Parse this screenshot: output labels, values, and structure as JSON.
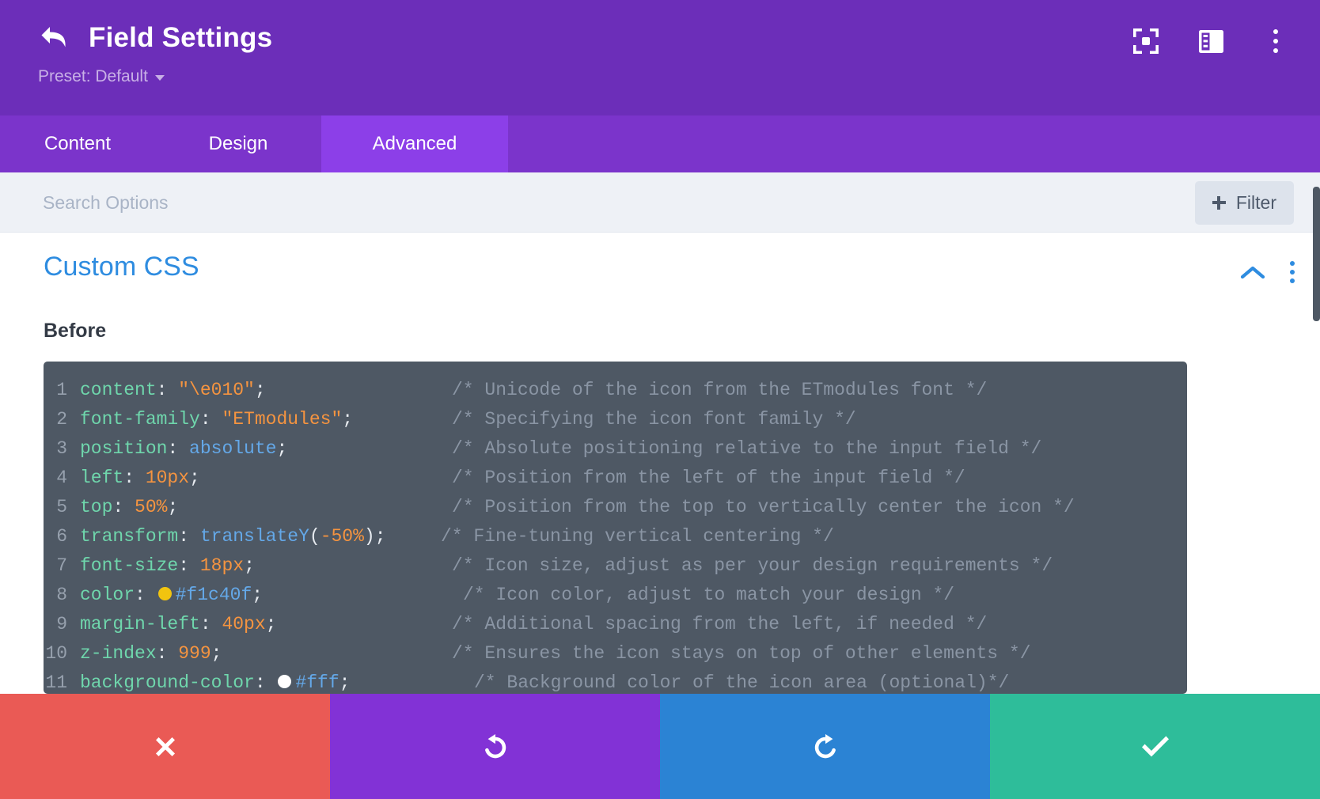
{
  "header": {
    "title": "Field Settings",
    "back_icon": "back-arrow-icon",
    "preset_label": "Preset: Default",
    "actions": [
      {
        "name": "focus-frame-icon",
        "label": "Focus"
      },
      {
        "name": "layout-panel-icon",
        "label": "Layout"
      },
      {
        "name": "more-vertical-icon",
        "label": "More"
      }
    ]
  },
  "tabs": [
    {
      "label": "Content",
      "active": false
    },
    {
      "label": "Design",
      "active": false
    },
    {
      "label": "Advanced",
      "active": true
    }
  ],
  "search": {
    "placeholder": "Search Options",
    "value": "",
    "filter_label": "Filter",
    "filter_icon": "plus-icon"
  },
  "section": {
    "title": "Custom CSS",
    "collapse_icon": "chevron-up-icon",
    "menu_icon": "more-vertical-icon"
  },
  "field": {
    "label": "Before"
  },
  "colors": {
    "header_purple": "#6c2eb9",
    "tab_bar_purple": "#7b34cb",
    "tab_active_purple": "#8c3fe8",
    "preset_text": "#c8b0e6",
    "searchbar_bg": "#eef1f6",
    "filter_bg": "#dde3ec",
    "section_title_blue": "#2e8ce0",
    "code_bg": "#4e5864",
    "cancel_red": "#ea5a55",
    "undo_purple": "#8232d6",
    "redo_blue": "#2b83d4",
    "save_teal": "#2ebd9a",
    "swatch_yellow": "#f1c40f",
    "swatch_white": "#ffffff"
  },
  "code": {
    "language": "css",
    "lines": [
      {
        "number": "1",
        "tokens": [
          {
            "t": "prop",
            "v": "content"
          },
          {
            "t": "punct",
            "v": ": "
          },
          {
            "t": "str",
            "v": "\"\\e010\""
          },
          {
            "t": "punct",
            "v": ";"
          }
        ],
        "comment": "/* Unicode of the icon from the ETmodules font */",
        "comment_indent": 0
      },
      {
        "number": "2",
        "tokens": [
          {
            "t": "prop",
            "v": "font-family"
          },
          {
            "t": "punct",
            "v": ": "
          },
          {
            "t": "str",
            "v": "\"ETmodules\""
          },
          {
            "t": "punct",
            "v": ";"
          }
        ],
        "comment": "/* Specifying the icon font family */",
        "comment_indent": 0
      },
      {
        "number": "3",
        "tokens": [
          {
            "t": "prop",
            "v": "position"
          },
          {
            "t": "punct",
            "v": ": "
          },
          {
            "t": "kw",
            "v": "absolute"
          },
          {
            "t": "punct",
            "v": ";"
          }
        ],
        "comment": "/* Absolute positioning relative to the input field */",
        "comment_indent": 0
      },
      {
        "number": "4",
        "tokens": [
          {
            "t": "prop",
            "v": "left"
          },
          {
            "t": "punct",
            "v": ": "
          },
          {
            "t": "num",
            "v": "10px"
          },
          {
            "t": "punct",
            "v": ";"
          }
        ],
        "comment": "/* Position from the left of the input field */",
        "comment_indent": 0
      },
      {
        "number": "5",
        "tokens": [
          {
            "t": "prop",
            "v": "top"
          },
          {
            "t": "punct",
            "v": ": "
          },
          {
            "t": "num",
            "v": "50%"
          },
          {
            "t": "punct",
            "v": ";"
          }
        ],
        "comment": "/* Position from the top to vertically center the icon */",
        "comment_indent": 0
      },
      {
        "number": "6",
        "tokens": [
          {
            "t": "prop",
            "v": "transform"
          },
          {
            "t": "punct",
            "v": ": "
          },
          {
            "t": "kw",
            "v": "translateY"
          },
          {
            "t": "punct",
            "v": "("
          },
          {
            "t": "num",
            "v": "-50%"
          },
          {
            "t": "punct",
            "v": ");"
          }
        ],
        "comment": "/* Fine-tuning vertical centering */",
        "comment_indent": -1
      },
      {
        "number": "7",
        "tokens": [
          {
            "t": "prop",
            "v": "font-size"
          },
          {
            "t": "punct",
            "v": ": "
          },
          {
            "t": "num",
            "v": "18px"
          },
          {
            "t": "punct",
            "v": ";"
          }
        ],
        "comment": "/* Icon size, adjust as per your design requirements */",
        "comment_indent": 0
      },
      {
        "number": "8",
        "tokens": [
          {
            "t": "prop",
            "v": "color"
          },
          {
            "t": "punct",
            "v": ": "
          },
          {
            "t": "swatch",
            "v": "#f1c40f"
          },
          {
            "t": "hex",
            "v": "#f1c40f"
          },
          {
            "t": "punct",
            "v": ";"
          }
        ],
        "comment": "/* Icon color, adjust to match your design */",
        "comment_indent": 1
      },
      {
        "number": "9",
        "tokens": [
          {
            "t": "prop",
            "v": "margin-left"
          },
          {
            "t": "punct",
            "v": ": "
          },
          {
            "t": "num",
            "v": "40px"
          },
          {
            "t": "punct",
            "v": ";"
          }
        ],
        "comment": "/* Additional spacing from the left, if needed */",
        "comment_indent": 0
      },
      {
        "number": "10",
        "tokens": [
          {
            "t": "prop",
            "v": "z-index"
          },
          {
            "t": "punct",
            "v": ": "
          },
          {
            "t": "num",
            "v": "999"
          },
          {
            "t": "punct",
            "v": ";"
          }
        ],
        "comment": "/* Ensures the icon stays on top of other elements */",
        "comment_indent": 0
      },
      {
        "number": "11",
        "tokens": [
          {
            "t": "prop",
            "v": "background-color"
          },
          {
            "t": "punct",
            "v": ": "
          },
          {
            "t": "swatch",
            "v": "#ffffff"
          },
          {
            "t": "hex",
            "v": "#fff"
          },
          {
            "t": "punct",
            "v": ";"
          }
        ],
        "comment": "/* Background color of the icon area (optional)*/",
        "comment_indent": 2
      }
    ]
  },
  "actionbar": [
    {
      "name": "cancel-button",
      "icon": "close-icon",
      "color": "#ea5a55"
    },
    {
      "name": "undo-button",
      "icon": "undo-icon",
      "color": "#8232d6"
    },
    {
      "name": "redo-button",
      "icon": "redo-icon",
      "color": "#2b83d4"
    },
    {
      "name": "save-button",
      "icon": "check-icon",
      "color": "#2ebd9a"
    }
  ]
}
